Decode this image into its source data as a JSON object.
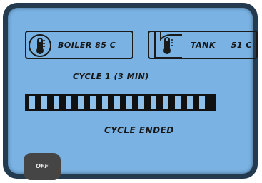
{
  "boiler": {
    "label": "BOILER 85 C",
    "icon": "thermometer-circle-icon"
  },
  "tank": {
    "label": "TANK",
    "value": "51 C",
    "icon": "thermometer-tank-icon"
  },
  "cycle": {
    "label": "CYCLE 1 (3 MIN)",
    "progress_segments": 15
  },
  "status": {
    "text": "CYCLE ENDED"
  },
  "off_button": {
    "label": "OFF"
  },
  "colors": {
    "screen": "#7ab3e3",
    "bezel": "#243a4e",
    "ink": "#161616",
    "button": "#454545"
  }
}
